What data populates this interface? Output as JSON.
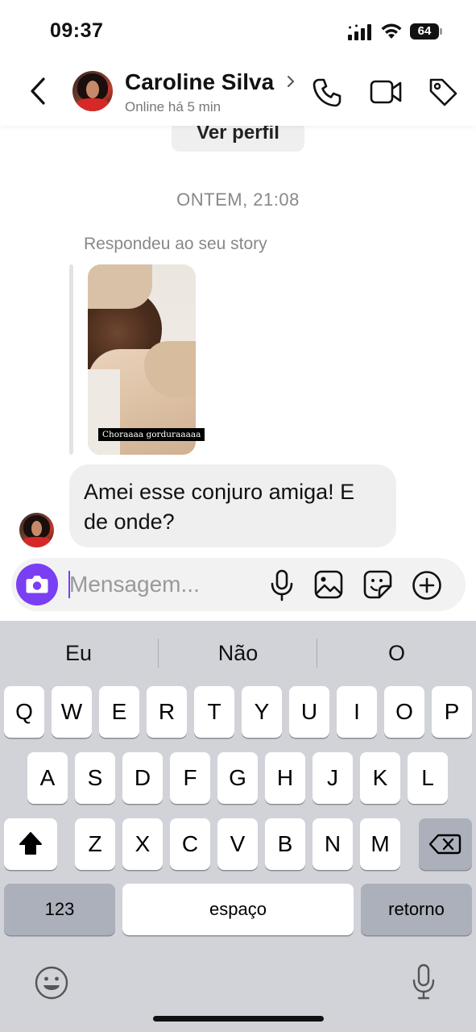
{
  "status_bar": {
    "time": "09:37",
    "battery": "64"
  },
  "header": {
    "contact_name": "Caroline Silva",
    "status": "Online há 5 min"
  },
  "chat": {
    "view_profile_label": "Ver perfil",
    "date_separator": "ONTEM, 21:08",
    "replied_label": "Respondeu ao seu story",
    "story_caption": "Choraaaa gorduraaaaa",
    "message_text": "Amei esse conjuro amiga! E de onde?"
  },
  "composer": {
    "placeholder": "Mensagem..."
  },
  "keyboard": {
    "suggestions": [
      "Eu",
      "Não",
      "O"
    ],
    "row1": [
      "Q",
      "W",
      "E",
      "R",
      "T",
      "Y",
      "U",
      "I",
      "O",
      "P"
    ],
    "row2": [
      "A",
      "S",
      "D",
      "F",
      "G",
      "H",
      "J",
      "K",
      "L"
    ],
    "row3": [
      "Z",
      "X",
      "C",
      "V",
      "B",
      "N",
      "M"
    ],
    "numbers_label": "123",
    "space_label": "espaço",
    "return_label": "retorno"
  },
  "icons": {
    "back": "chevron-left-icon",
    "call": "phone-icon",
    "video": "video-camera-icon",
    "tag": "tag-icon",
    "camera": "camera-icon",
    "mic": "microphone-icon",
    "gallery": "image-icon",
    "sticker": "sticker-icon",
    "plus": "plus-circle-icon",
    "shift": "shift-icon",
    "delete": "backspace-icon",
    "emoji": "emoji-icon",
    "dictation": "dictation-mic-icon"
  },
  "colors": {
    "accent": "#7a3ef3",
    "bubble": "#efefef",
    "keyboard_bg": "#d1d3d9"
  }
}
